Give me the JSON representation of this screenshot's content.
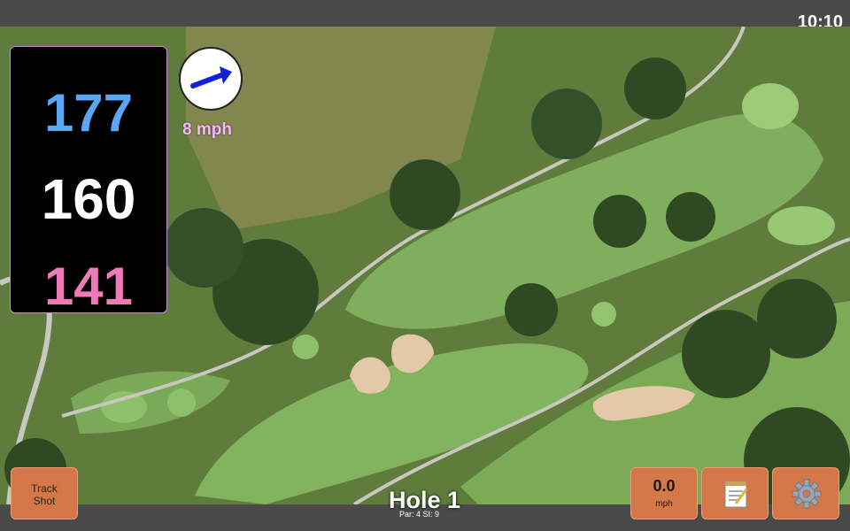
{
  "status": {
    "time": "10:10"
  },
  "distances": {
    "back": "177",
    "middle": "160",
    "front": "141"
  },
  "wind": {
    "speed_text": "8 mph",
    "icon": "arrow-icon"
  },
  "hole": {
    "title": "Hole 1",
    "subtitle": "Par: 4   SI: 9"
  },
  "buttons": {
    "track_shot": "Track\nShot",
    "wind_value": "0.0",
    "wind_unit": "mph",
    "notes_icon": "notepad-icon",
    "settings_icon": "gear-icon"
  },
  "colors": {
    "back": "#5aa8f5",
    "middle": "#ffffff",
    "front": "#f07ab8",
    "button": "#d4784a"
  }
}
